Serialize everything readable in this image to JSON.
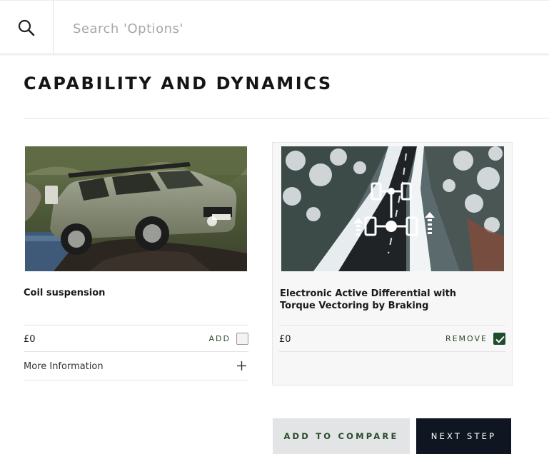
{
  "search": {
    "placeholder": "Search 'Options'",
    "value": ""
  },
  "section": {
    "title": "CAPABILITY AND DYNAMICS"
  },
  "options": [
    {
      "name": "Coil suspension",
      "price": "£0",
      "action_label": "ADD",
      "selected": false,
      "more_info_label": "More Information"
    },
    {
      "name": "Electronic Active Differential with Torque Vectoring by Braking",
      "price": "£0",
      "action_label": "REMOVE",
      "selected": true
    }
  ],
  "buttons": {
    "compare": "ADD TO COMPARE",
    "next": "NEXT STEP"
  },
  "colors": {
    "accent_green": "#1f4d2b",
    "next_button_bg": "#0f1621",
    "compare_button_bg": "#e2e4e6"
  }
}
